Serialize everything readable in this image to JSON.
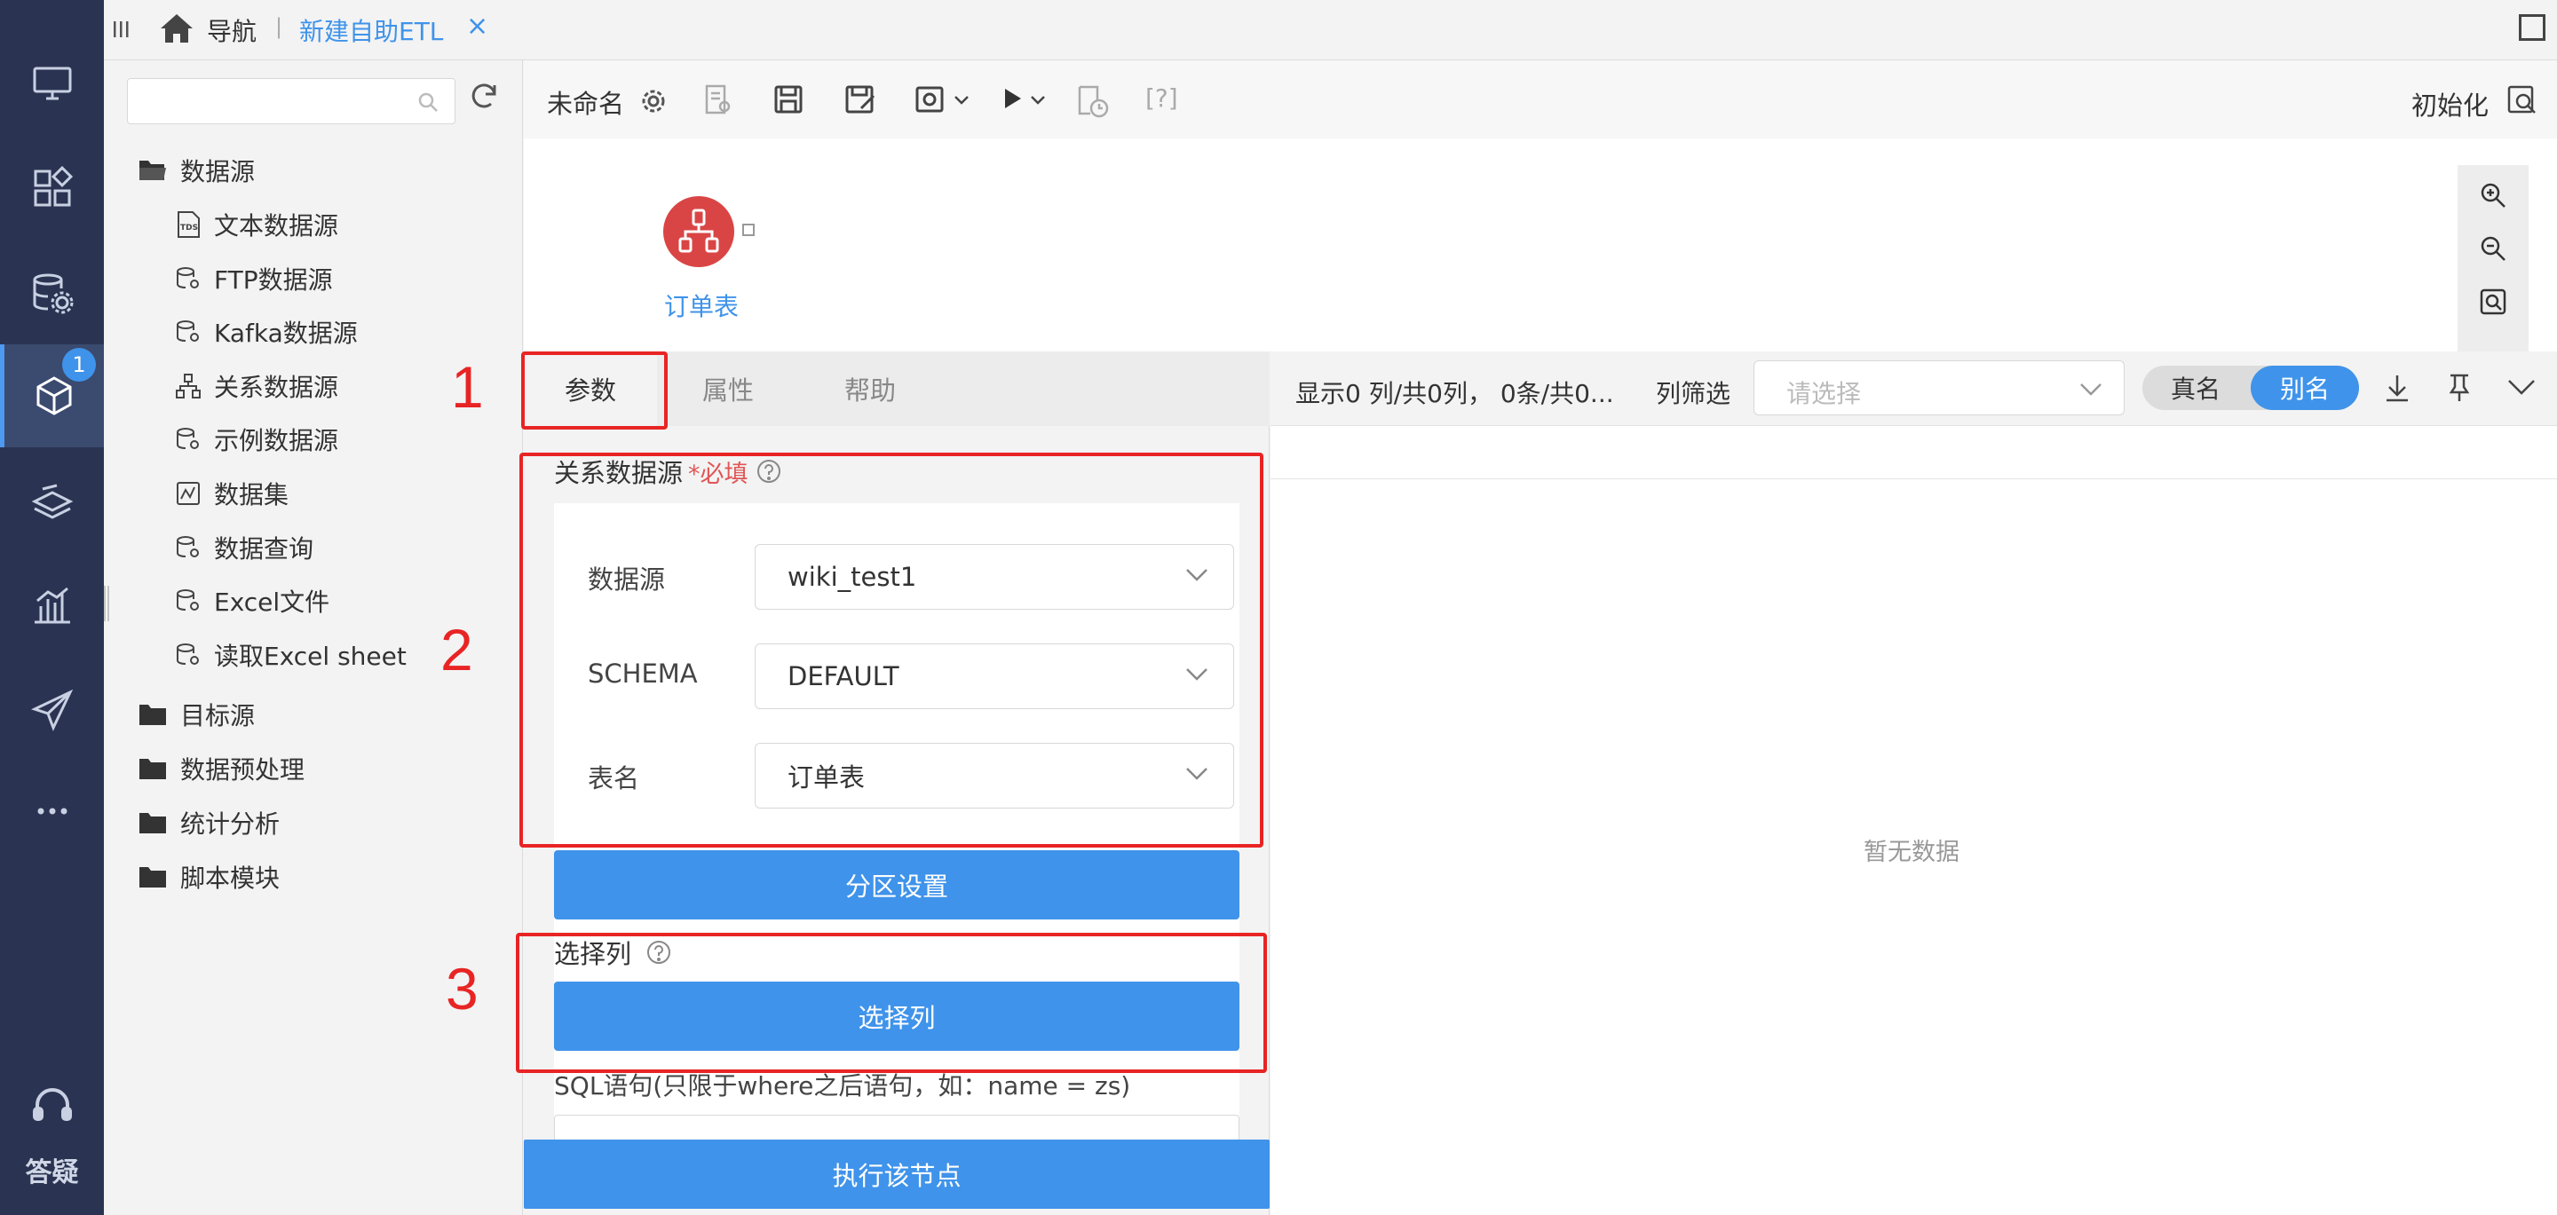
{
  "leftnav": {
    "badge_count": "1",
    "help_label": "答疑",
    "icons": [
      "monitor-icon",
      "dashboard-icon",
      "database-gear-icon",
      "cube-icon",
      "layers-icon",
      "bar-chart-icon",
      "paper-plane-icon",
      "more-icon",
      "headset-icon"
    ]
  },
  "topbar": {
    "home_label": "导航",
    "separator": "|",
    "active_tab": "新建自助ETL",
    "close_glyph": "×"
  },
  "tree": {
    "search_placeholder": "",
    "datasource_folder": "数据源",
    "datasource_items": [
      "文本数据源",
      "FTP数据源",
      "Kafka数据源",
      "关系数据源",
      "示例数据源",
      "数据集",
      "数据查询",
      "Excel文件",
      "读取Excel sheet"
    ],
    "folders": [
      "目标源",
      "数据预处理",
      "统计分析",
      "脚本模块"
    ]
  },
  "toolbar": {
    "name": "未命名",
    "help_text": "[?]",
    "init_label": "初始化"
  },
  "canvas": {
    "node_label": "订单表"
  },
  "params": {
    "tabs": [
      "参数",
      "属性",
      "帮助"
    ],
    "section_title": "关系数据源",
    "required_mark": "*必填",
    "fields": [
      {
        "label": "数据源",
        "value": "wiki_test1"
      },
      {
        "label": "SCHEMA",
        "value": "DEFAULT"
      },
      {
        "label": "表名",
        "value": "订单表"
      }
    ],
    "partition_button": "分区设置",
    "select_cols_title": "选择列",
    "select_cols_button": "选择列",
    "sql_label": "SQL语句(只限于where之后语句，如：name = zs)",
    "execute_button": "执行该节点"
  },
  "annotations": {
    "numbers": [
      "1",
      "2",
      "3"
    ],
    "color": "#e82424"
  },
  "preview": {
    "status": "显示0 列/共0列， 0条/共0...",
    "filter_label": "列筛选",
    "filter_placeholder": "请选择",
    "toggle_real": "真名",
    "toggle_alias": "别名",
    "empty_text": "暂无数据"
  },
  "colors": {
    "nav_bg": "#2a3452",
    "accent": "#3f93ea",
    "node_red": "#d94545"
  }
}
